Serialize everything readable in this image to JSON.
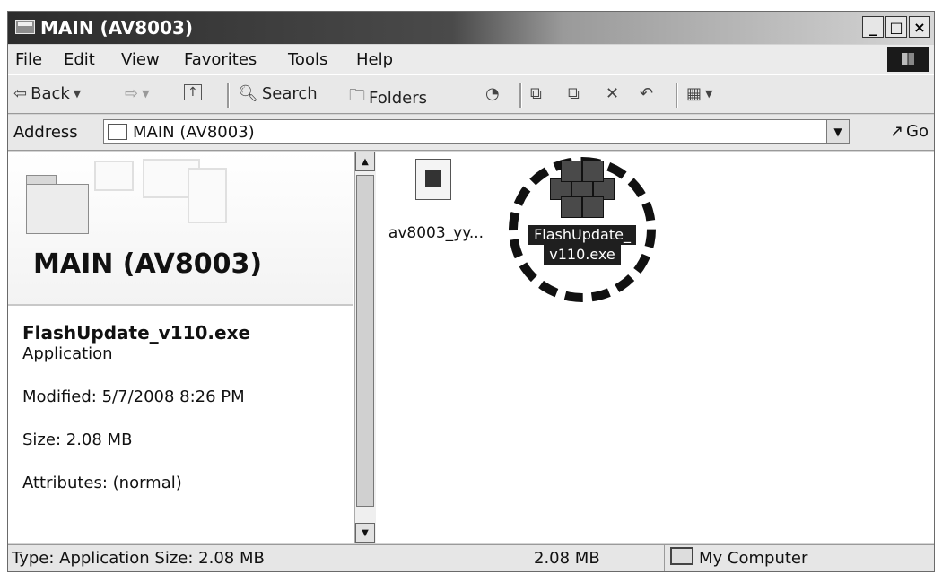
{
  "window": {
    "title": "MAIN (AV8003)",
    "controls": [
      "_",
      "□",
      "×"
    ]
  },
  "menu": {
    "items": [
      {
        "label": "File"
      },
      {
        "label": "Edit"
      },
      {
        "label": "View"
      },
      {
        "label": "Favorites"
      },
      {
        "label": "Tools"
      },
      {
        "label": "Help"
      }
    ]
  },
  "toolbar": {
    "back": "Back",
    "search": "Search",
    "folders": "Folders"
  },
  "address": {
    "label": "Address",
    "value": "MAIN (AV8003)",
    "go": "Go"
  },
  "left_pane": {
    "title": "MAIN (AV8003)",
    "file_name": "FlashUpdate_v110.exe",
    "file_type": "Application",
    "modified": "Modified: 5/7/2008 8:26 PM",
    "size": "Size: 2.08 MB",
    "attributes": "Attributes: (normal)"
  },
  "files": [
    {
      "label": "av8003_yy...",
      "icon": "document-icon",
      "selected": false
    },
    {
      "label_line1": "FlashUpdate_",
      "label_line2": "v110.exe",
      "icon": "installer-icon",
      "selected": true
    }
  ],
  "status": {
    "type_size": "Type: Application Size: 2.08 MB",
    "size": "2.08 MB",
    "location": "My Computer"
  }
}
